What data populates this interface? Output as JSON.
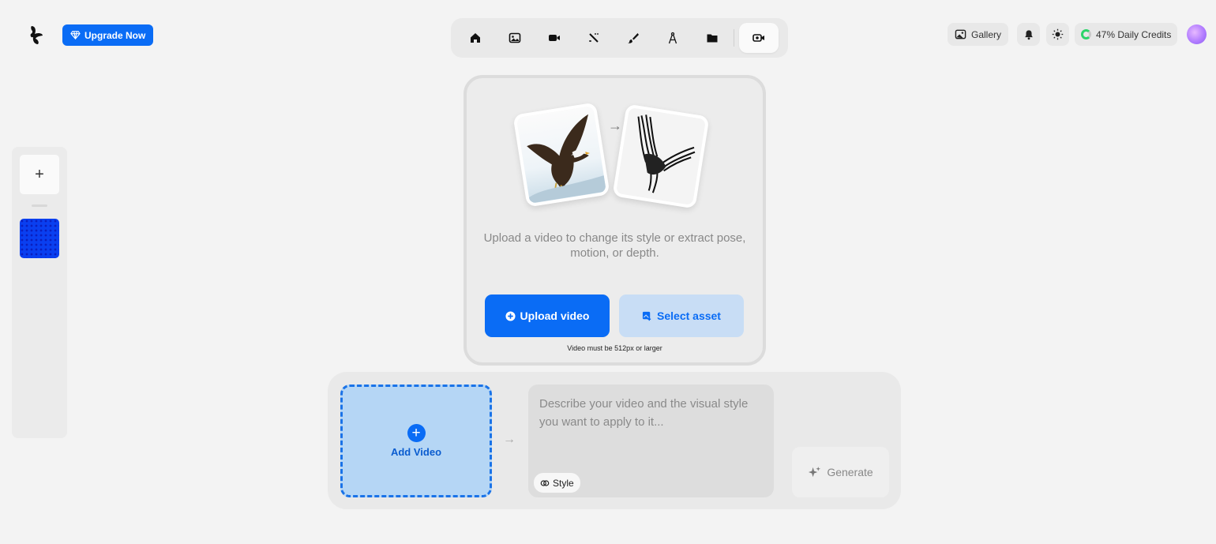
{
  "header": {
    "logo_icon": "krea-logo-icon",
    "upgrade_label": "Upgrade Now",
    "accent": "#0a6cf5"
  },
  "nav": {
    "items": [
      {
        "name": "home",
        "icon": "home-icon"
      },
      {
        "name": "image",
        "icon": "image-icon"
      },
      {
        "name": "video",
        "icon": "video-camera-icon"
      },
      {
        "name": "enhance",
        "icon": "magic-wand-icon"
      },
      {
        "name": "edit",
        "icon": "brush-icon"
      },
      {
        "name": "train",
        "icon": "compass-icon"
      },
      {
        "name": "assets",
        "icon": "folder-icon"
      },
      {
        "name": "video-restyle",
        "icon": "video-restyle-icon",
        "active": true
      }
    ]
  },
  "topright": {
    "gallery_label": "Gallery",
    "credits_label": "47% Daily Credits",
    "credits_color": "#2bd46a"
  },
  "sidebar": {
    "add_label": "+"
  },
  "upload": {
    "description": "Upload a video to change its style or extract pose, motion, or depth.",
    "upload_label": "Upload video",
    "select_label": "Select asset",
    "size_note": "Video must be 512px or larger"
  },
  "composer": {
    "add_video_label": "Add Video",
    "prompt_placeholder": "Describe your video and the visual style you want to apply to it...",
    "style_label": "Style",
    "generate_label": "Generate"
  }
}
